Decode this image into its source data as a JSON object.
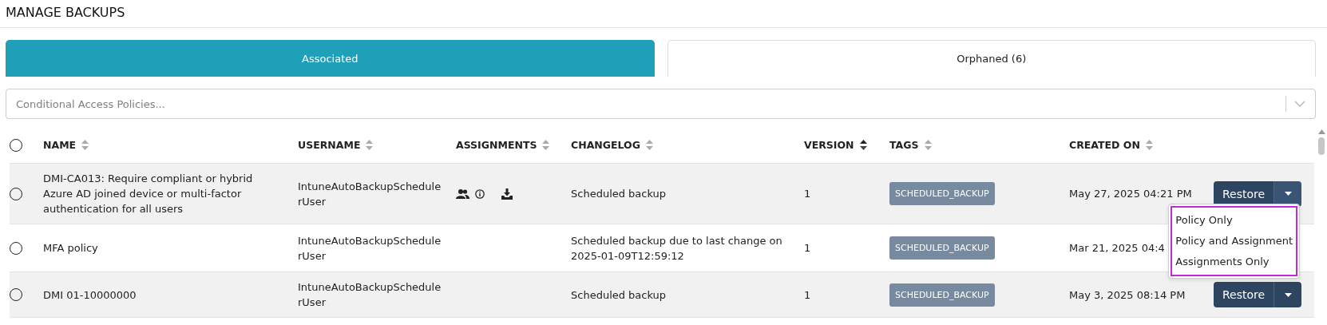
{
  "page_title": "MANAGE BACKUPS",
  "tabs": [
    {
      "label": "Associated",
      "selected": true
    },
    {
      "label": "Orphaned (6)",
      "selected": false
    }
  ],
  "policy_select": {
    "placeholder": "Conditional Access Policies..."
  },
  "table": {
    "select_all": {
      "selected": false
    },
    "columns": [
      {
        "label": "NAME",
        "sorted": false
      },
      {
        "label": "USERNAME",
        "sorted": false
      },
      {
        "label": "ASSIGNMENTS",
        "sorted": false
      },
      {
        "label": "CHANGELOG",
        "sorted": false
      },
      {
        "label": "VERSION",
        "sorted": true
      },
      {
        "label": "TAGS",
        "sorted": false
      },
      {
        "label": "CREATED ON",
        "sorted": false
      }
    ],
    "rows": [
      {
        "selected": false,
        "name": "DMI-CA013: Require compliant or hybrid Azure AD joined device or multi-factor authentication for all users",
        "username": "IntuneAutoBackupSchedulerUser",
        "has_assignments": true,
        "changelog": "Scheduled backup",
        "version": "1",
        "tags": [
          "SCHEDULED_BACKUP"
        ],
        "created_on": "May 27, 2025 04:21 PM",
        "restore": {
          "label": "Restore",
          "menu_open": true,
          "menu_outlined": true,
          "menu": [
            "Policy Only",
            "Policy and Assignment",
            "Assignments Only"
          ]
        }
      },
      {
        "selected": false,
        "name": "MFA policy",
        "username": "IntuneAutoBackupSchedulerUser",
        "has_assignments": false,
        "changelog": "Scheduled backup due to last change on 2025-01-09T12:59:12",
        "version": "1",
        "tags": [
          "SCHEDULED_BACKUP"
        ],
        "created_on": "Mar 21, 2025 04:4"
      },
      {
        "selected": false,
        "name": "DMI 01-10000000",
        "username": "IntuneAutoBackupSchedulerUser",
        "has_assignments": false,
        "changelog": "Scheduled backup",
        "version": "1",
        "tags": [
          "SCHEDULED_BACKUP"
        ],
        "created_on": "May 3, 2025 08:14 PM",
        "restore": {
          "label": "Restore"
        }
      }
    ]
  }
}
